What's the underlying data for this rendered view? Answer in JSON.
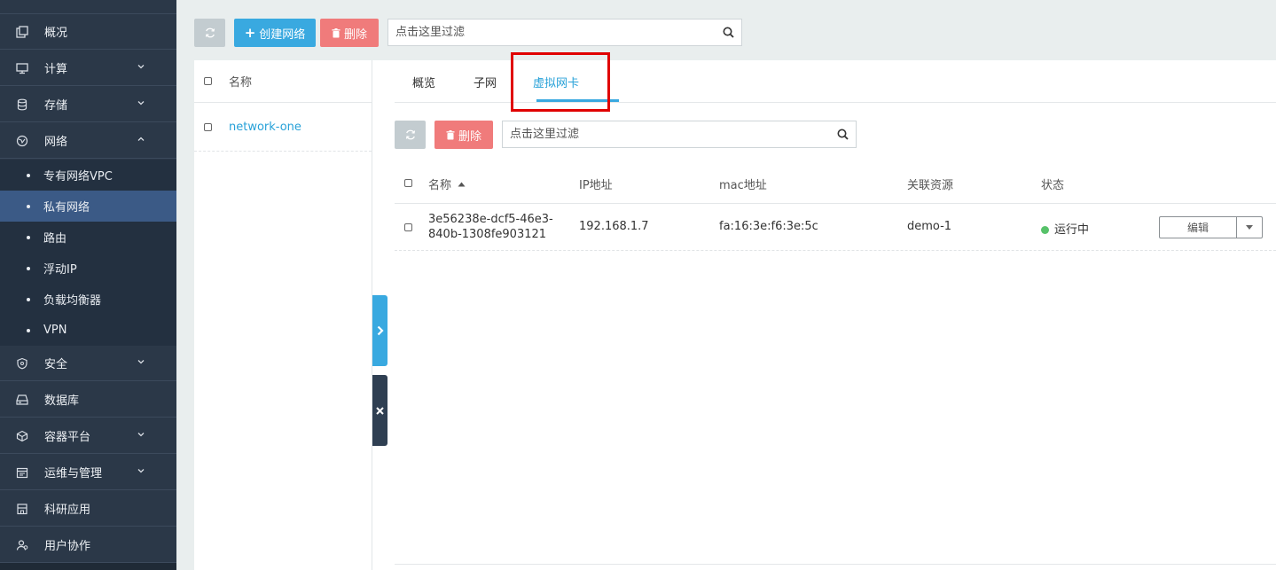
{
  "sidebar": {
    "items": [
      {
        "label": "概况",
        "icon": "overview-icon"
      },
      {
        "label": "计算",
        "icon": "monitor-icon"
      },
      {
        "label": "存储",
        "icon": "database-icon"
      },
      {
        "label": "网络",
        "icon": "network-icon"
      },
      {
        "label": "安全",
        "icon": "shield-icon"
      },
      {
        "label": "数据库",
        "icon": "drive-icon"
      },
      {
        "label": "容器平台",
        "icon": "cube-icon"
      },
      {
        "label": "运维与管理",
        "icon": "calendar-icon"
      },
      {
        "label": "科研应用",
        "icon": "building-icon"
      },
      {
        "label": "用户协作",
        "icon": "users-icon"
      }
    ],
    "network_sub": [
      {
        "label": "专有网络VPC"
      },
      {
        "label": "私有网络",
        "active": true
      },
      {
        "label": "路由"
      },
      {
        "label": "浮动IP"
      },
      {
        "label": "负载均衡器"
      },
      {
        "label": "VPN"
      }
    ]
  },
  "toolbar": {
    "create_label": "创建网络",
    "delete_label": "删除",
    "search_placeholder": "点击这里过滤"
  },
  "list": {
    "header": "名称",
    "rows": [
      "network-one"
    ]
  },
  "detail": {
    "tabs": [
      "概览",
      "子网",
      "虚拟网卡"
    ],
    "active_tab": "虚拟网卡",
    "delete_label": "删除",
    "search_placeholder": "点击这里过滤",
    "columns": [
      "名称",
      "IP地址",
      "mac地址",
      "关联资源",
      "状态"
    ],
    "rows": [
      {
        "name_line1": "3e56238e-dcf5-46e3-",
        "name_line2": "840b-1308fe903121",
        "ip": "192.168.1.7",
        "mac": "fa:16:3e:f6:3e:5c",
        "resource": "demo-1",
        "status": "运行中",
        "action": "编辑"
      }
    ]
  },
  "colors": {
    "sidebar_bg": "#2b3848",
    "active_sub": "#3b5a86",
    "primary": "#39a9e0",
    "danger": "#f07b7b",
    "link": "#27a1d8",
    "status_running": "#57c26a",
    "highlight": "#e00000"
  }
}
